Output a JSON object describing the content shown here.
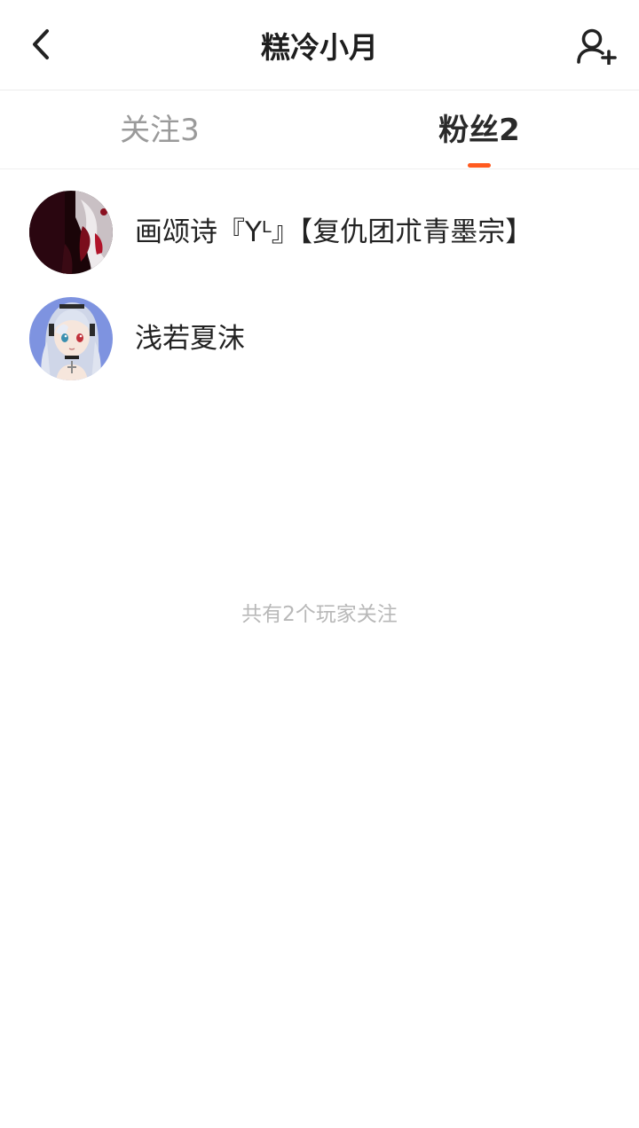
{
  "header": {
    "title": "糕冷小月",
    "back_icon": "chevron-left-icon",
    "add_user_icon": "add-user-icon"
  },
  "tabs": [
    {
      "label": "关注3",
      "active": false
    },
    {
      "label": "粉丝2",
      "active": true
    }
  ],
  "accent_color": "#ff5a1f",
  "fans": [
    {
      "name": "画颂诗『Yᴸ』【复仇团朮青墨宗】",
      "avatar": "dark-anime-avatar"
    },
    {
      "name": "浅若夏沫",
      "avatar": "silver-hair-anime-avatar"
    }
  ],
  "footer_note": "共有2个玩家关注"
}
